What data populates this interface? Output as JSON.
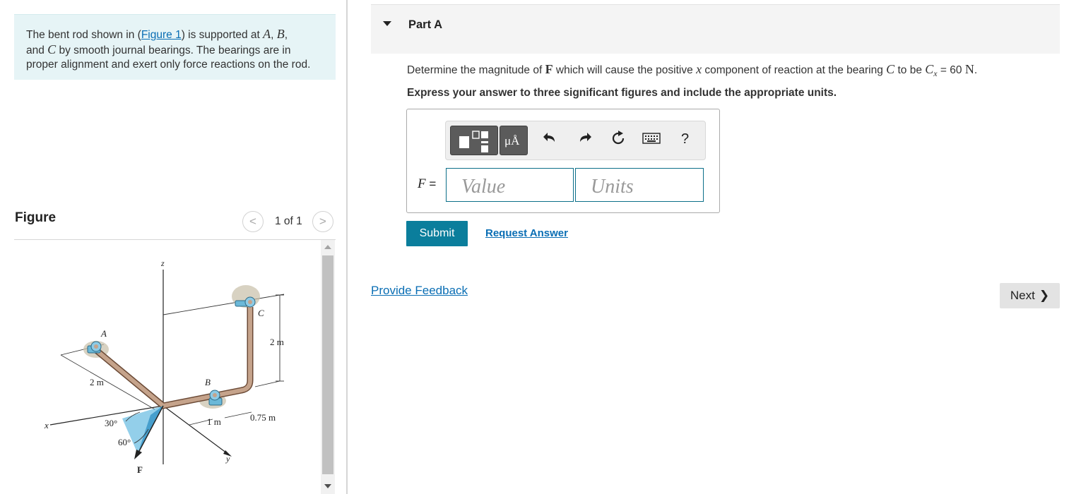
{
  "problem": {
    "text_1": "The bent rod shown in (",
    "figure_link": "Figure 1",
    "text_2": ") is supported at ",
    "A": "A",
    "comma_1": ", ",
    "B": "B",
    "comma_2": ",",
    "text_3": "and ",
    "C": "C",
    "text_4": " by smooth journal bearings. The bearings are in",
    "text_5": "proper alignment and exert only force reactions on the rod."
  },
  "figure_panel": {
    "title": "Figure",
    "prev_glyph": "<",
    "next_glyph": ">",
    "page_count": "1 of 1"
  },
  "diagram": {
    "labels": {
      "z": "z",
      "C": "C",
      "A": "A",
      "dim_2m_vert": "2 m",
      "dim_2m_arm": "2 m",
      "B": "B",
      "x": "x",
      "angle_30": "30°",
      "dim_1m": "1 m",
      "dim_075m": "0.75 m",
      "angle_60": "60°",
      "y": "y",
      "F": "F"
    },
    "colors": {
      "rod": "#c5a38b",
      "rod_outline": "#6b4a36",
      "bearing": "#6bb8d8",
      "force_triangle": "#3ba7d9",
      "shadow": "#c8bfa8"
    }
  },
  "part": {
    "title": "Part A"
  },
  "question": {
    "t1": "Determine the magnitude of ",
    "F": "F",
    "t2": " which will cause the positive ",
    "x": "x",
    "t3": " component of reaction at the bearing ",
    "C": "C",
    "t4": " to be ",
    "Cx": "C",
    "Cx_sub": "x",
    "t5": " = 60 ",
    "unit": "N",
    "t6": "."
  },
  "instruction": "Express your answer to three significant figures and include the appropriate units.",
  "toolbar": {
    "units_glyph": "μÅ",
    "help": "?"
  },
  "answer": {
    "variable": "F",
    "equals": " =",
    "value_placeholder": "Value",
    "units_placeholder": "Units"
  },
  "actions": {
    "submit": "Submit",
    "request_answer": "Request Answer",
    "feedback": "Provide Feedback",
    "next": "Next",
    "next_glyph": "❯"
  }
}
